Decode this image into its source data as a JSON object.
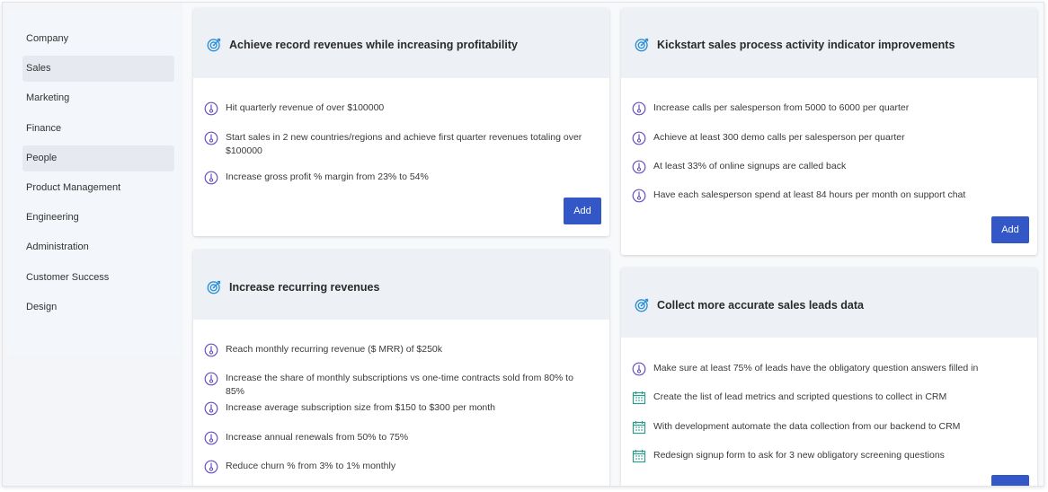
{
  "sidebar": {
    "items": [
      {
        "label": "Company"
      },
      {
        "label": "Sales"
      },
      {
        "label": "Marketing"
      },
      {
        "label": "Finance"
      },
      {
        "label": "People"
      },
      {
        "label": "Product Management"
      },
      {
        "label": "Engineering"
      },
      {
        "label": "Administration"
      },
      {
        "label": "Customer Success"
      },
      {
        "label": "Design"
      }
    ]
  },
  "objectives": [
    {
      "title": "Achieve record revenues while increasing profitability",
      "key_results": [
        {
          "text": "Hit quarterly revenue of over $100000",
          "icon": "gauge-icon"
        },
        {
          "text": "Start sales in 2 new countries/regions and achieve first quarter revenues totaling over $100000",
          "icon": "gauge-icon"
        },
        {
          "text": "Increase gross profit % margin from 23% to 54%",
          "icon": "gauge-icon"
        }
      ],
      "add_label": "Add"
    },
    {
      "title": "Kickstart sales process activity indicator improvements",
      "key_results": [
        {
          "text": "Increase calls per salesperson from 5000 to 6000 per quarter",
          "icon": "gauge-icon"
        },
        {
          "text": "Achieve at least 300 demo calls per salesperson per quarter",
          "icon": "gauge-icon"
        },
        {
          "text": "At least 33% of online signups are called back",
          "icon": "gauge-icon"
        },
        {
          "text": "Have each salesperson spend at least 84 hours per month on support chat",
          "icon": "gauge-icon"
        }
      ],
      "add_label": "Add"
    },
    {
      "title": "Increase recurring revenues",
      "key_results": [
        {
          "text": "Reach monthly recurring revenue ($ MRR) of $250k",
          "icon": "gauge-icon"
        },
        {
          "text": "Increase the share of monthly subscriptions vs one-time contracts sold from 80% to 85%",
          "icon": "gauge-icon"
        },
        {
          "text": "Increase average subscription size from $150 to $300 per month",
          "icon": "gauge-icon"
        },
        {
          "text": "Increase annual renewals from 50% to 75%",
          "icon": "gauge-icon"
        },
        {
          "text": "Reduce churn % from 3% to 1% monthly",
          "icon": "gauge-icon"
        }
      ]
    },
    {
      "title": "Collect more accurate sales leads data",
      "key_results": [
        {
          "text": "Make sure at least 75% of leads have the obligatory question answers filled in",
          "icon": "gauge-icon"
        },
        {
          "text": "Create the list of lead metrics and scripted questions to collect in CRM",
          "icon": "calendar-icon"
        },
        {
          "text": "With development automate the data collection from our backend to CRM",
          "icon": "calendar-icon"
        },
        {
          "text": "Redesign signup form to ask for 3 new obligatory screening questions",
          "icon": "calendar-icon"
        }
      ]
    }
  ],
  "colors": {
    "accent": "#3457c7",
    "target_icon": "#2a8fd6",
    "gauge_icon": "#6b4fbf",
    "calendar_icon": "#2e9a8a"
  }
}
